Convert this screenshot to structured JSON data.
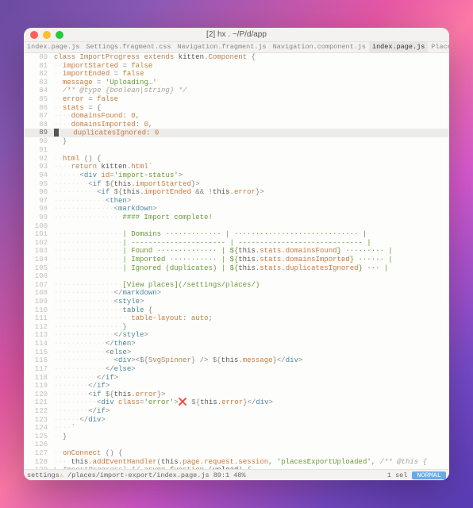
{
  "window": {
    "title": "[2] hx . ~/P/d/app"
  },
  "tabs": [
    {
      "label": "index.page.js",
      "active": false
    },
    {
      "label": "Settings.fragment.css",
      "active": false
    },
    {
      "label": "Navigation.fragment.js",
      "active": false
    },
    {
      "label": "Navigation.component.js",
      "active": false
    },
    {
      "label": "index.page.js",
      "active": true
    },
    {
      "label": "Place",
      "active": false
    }
  ],
  "current_line": 89,
  "lines": {
    "l80": {
      "n": "80",
      "c1": "class",
      "c2": "ImportProgress",
      "c3": "extends",
      "c4": "kitten",
      "c5": "Component",
      "brace": "{"
    },
    "l81": {
      "n": "81",
      "p": "importStarted",
      "eq": "=",
      "v": "false"
    },
    "l82": {
      "n": "82",
      "p": "importEnded",
      "eq": "=",
      "v": "false"
    },
    "l83": {
      "n": "83",
      "p": "message",
      "eq": "=",
      "v": "'Uploading…'"
    },
    "l84": {
      "n": "84",
      "c": "/** @type {boolean|string} */"
    },
    "l85": {
      "n": "85",
      "p": "error",
      "eq": "=",
      "v": "false"
    },
    "l86": {
      "n": "86",
      "p": "stats",
      "eq": "=",
      "brace": "{"
    },
    "l87": {
      "n": "87",
      "p": "domainsFound",
      "v": "0"
    },
    "l88": {
      "n": "88",
      "p": "domainsImported",
      "v": "0"
    },
    "l89": {
      "n": "89",
      "p": "duplicatesIgnored",
      "v": "0"
    },
    "l90": {
      "n": "90",
      "brace": "}"
    },
    "l91": {
      "n": "91"
    },
    "l92": {
      "n": "92",
      "fn": "html",
      "brace": "{"
    },
    "l93": {
      "n": "93",
      "kw": "return",
      "obj": "kitten",
      "m": "html",
      "tick": "`"
    },
    "l94": {
      "n": "94",
      "tag": "div",
      "attr": "id",
      "val": "'import-status'"
    },
    "l95": {
      "n": "95",
      "tag": "if",
      "expr1": "this",
      "expr2": "importStarted"
    },
    "l96": {
      "n": "96",
      "tag": "if",
      "e1": "this",
      "e2": "importEnded",
      "amp": "&&",
      "not": "!",
      "e3": "this",
      "e4": "error"
    },
    "l97": {
      "n": "97",
      "tag": "then"
    },
    "l98": {
      "n": "98",
      "tag": "markdown"
    },
    "l99": {
      "n": "99",
      "txt": "#### Import complete!"
    },
    "l100": {
      "n": "100"
    },
    "l101": {
      "n": "101",
      "txt": "| Domains ············· | ····························· |"
    },
    "l102": {
      "n": "102",
      "txt": "| ---------------------- | ----------------------------- |"
    },
    "l103": {
      "n": "103",
      "t1": "| Found ·············· | ${",
      "e1": "this",
      "e2": "stats",
      "e3": "domainsFound",
      "t2": "} ········· |"
    },
    "l104": {
      "n": "104",
      "t1": "| Imported ··········· | ${",
      "e1": "this",
      "e2": "stats",
      "e3": "domainsImported",
      "t2": "} ······ |"
    },
    "l105": {
      "n": "105",
      "t1": "| Ignored (duplicates) | ${",
      "e1": "this",
      "e2": "stats",
      "e3": "duplicatesIgnored",
      "t2": "} ··· |"
    },
    "l106": {
      "n": "106"
    },
    "l107": {
      "n": "107",
      "txt": "[View places](/settings/places/)"
    },
    "l108": {
      "n": "108",
      "tag": "markdown"
    },
    "l109": {
      "n": "109",
      "tag": "style"
    },
    "l110": {
      "n": "110",
      "sel": "table",
      "brace": "{"
    },
    "l111": {
      "n": "111",
      "prop": "table-layout",
      "val": "auto"
    },
    "l112": {
      "n": "112",
      "brace": "}"
    },
    "l113": {
      "n": "113",
      "tag": "style"
    },
    "l114": {
      "n": "114",
      "tag": "then"
    },
    "l115": {
      "n": "115",
      "tag": "else"
    },
    "l116": {
      "n": "116",
      "tag": "div",
      "comp": "SvgSpinner",
      "e1": "this",
      "e2": "message"
    },
    "l117": {
      "n": "117",
      "tag": "else"
    },
    "l118": {
      "n": "118",
      "tag": "if"
    },
    "l119": {
      "n": "119",
      "tag": "if"
    },
    "l120": {
      "n": "120",
      "tag": "if",
      "e1": "this",
      "e2": "error"
    },
    "l121": {
      "n": "121",
      "tag": "div",
      "attr": "class",
      "val": "'error'",
      "x": "❌",
      "e1": "this",
      "e2": "error"
    },
    "l122": {
      "n": "122",
      "tag": "if"
    },
    "l123": {
      "n": "123",
      "tag": "div"
    },
    "l124": {
      "n": "124",
      "tick": "`"
    },
    "l125": {
      "n": "125",
      "brace": "}"
    },
    "l126": {
      "n": "126"
    },
    "l127": {
      "n": "127",
      "fn": "onConnect",
      "brace": "{"
    },
    "l128": {
      "n": "128",
      "e1": "this",
      "m": "addEventHandler",
      "a1": "this",
      "a2": "page",
      "a3": "request",
      "a4": "session",
      "s": "'placesExportUploaded'",
      "c": "/** @this {"
    },
    "l129": {
      "n": "129",
      "c": "↳ ImportProgress} */",
      "kw": "async",
      "kw2": "function",
      "arg": "upload",
      "brace": "{"
    }
  },
  "status": {
    "left_icon": "⚠",
    "left_prefix": "settings",
    "path": "/places/import-export/index.page.js",
    "pos": "89:1",
    "pct": "48%",
    "sel": "1 sel",
    "mode": "NORMAL"
  }
}
